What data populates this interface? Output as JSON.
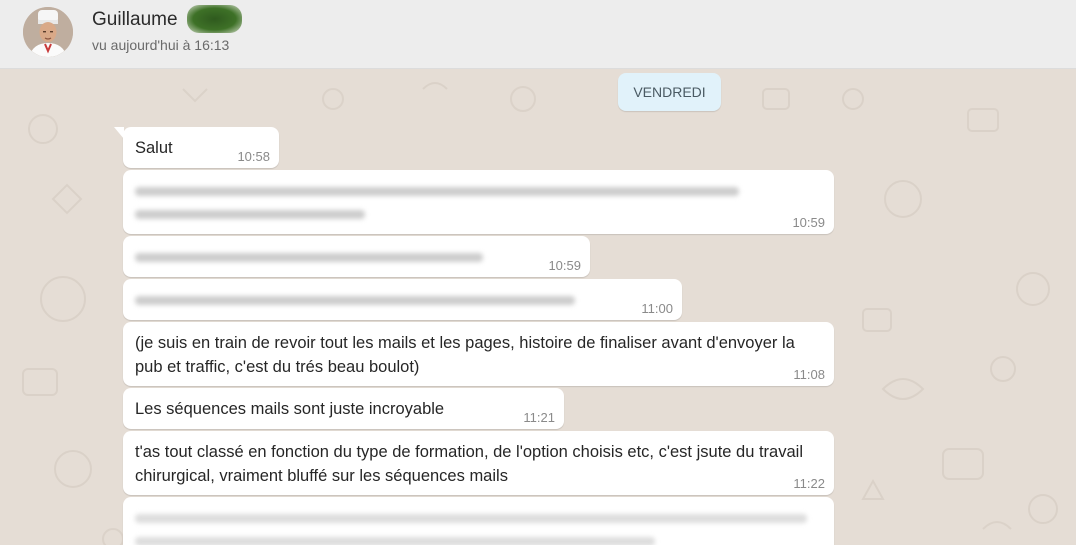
{
  "header": {
    "contact_name": "Guillaume",
    "last_seen": "vu aujourd'hui à 16:13"
  },
  "chat": {
    "day_label": "VENDREDI",
    "messages": [
      {
        "text": "Salut",
        "time": "10:58"
      },
      {
        "text": "",
        "time": "10:59"
      },
      {
        "text": "",
        "time": "10:59"
      },
      {
        "text": "",
        "time": "11:00"
      },
      {
        "text": "(je suis en train de revoir tout les mails et les pages, histoire de finaliser avant d'envoyer la pub et traffic, c'est du trés beau boulot)",
        "time": "11:08"
      },
      {
        "text": "Les séquences mails sont juste incroyable",
        "time": "11:21"
      },
      {
        "text": "t'as tout classé en fonction du type de formation, de l'option choisis etc, c'est jsute du travail chirurgical, vraiment bluffé sur les séquences mails",
        "time": "11:22"
      },
      {
        "text": "",
        "time": ""
      }
    ]
  },
  "colors": {
    "header_bg": "#ededed",
    "chat_bg": "#e5ddd5",
    "bubble_bg": "#ffffff",
    "day_badge_bg": "#e1f2fa",
    "time_text": "#8a8a8a"
  },
  "icons": {
    "avatar": "chef-avatar"
  }
}
